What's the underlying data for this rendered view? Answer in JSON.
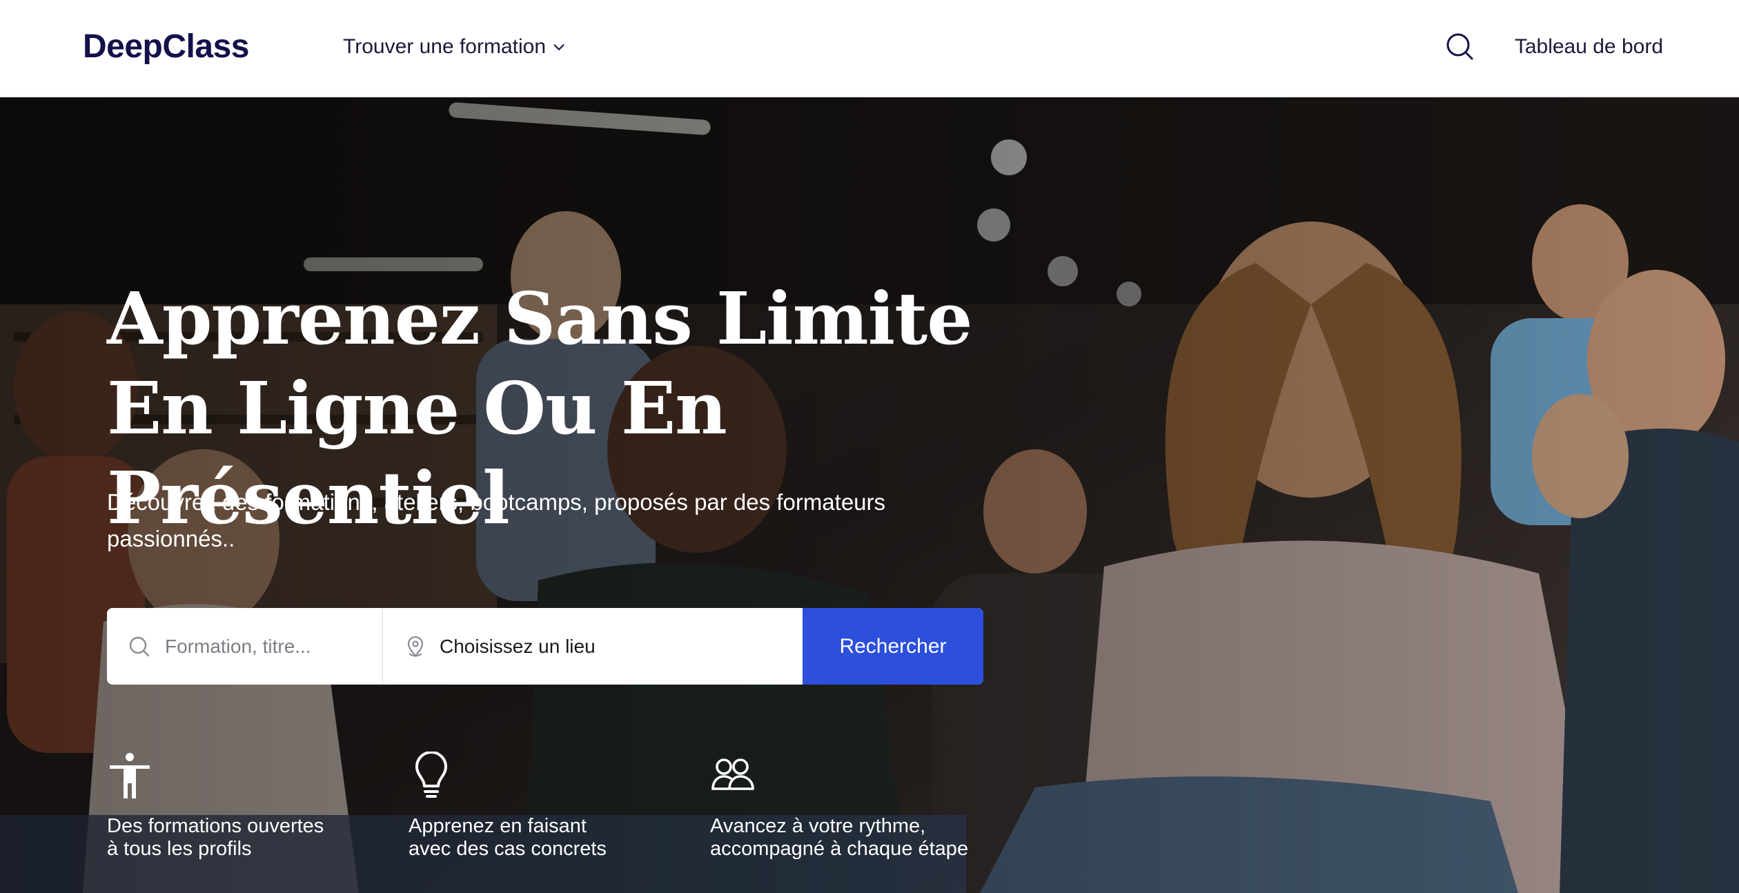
{
  "header": {
    "logo": "DeepClass",
    "nav_dropdown_label": "Trouver une formation",
    "search_icon": "search-icon",
    "dashboard_label": "Tableau de bord",
    "logo_color": "#13114a"
  },
  "hero": {
    "title": "Apprenez Sans Limite En Ligne Ou En Présentiel",
    "subtitle": "Découvrez des formations, ateliers, bootcamps, proposés par des formateurs passionnés..",
    "background": "photo-students-classroom"
  },
  "search": {
    "placeholder": "Formation, titre...",
    "location_label": "Choisissez un lieu",
    "button_label": "Rechercher",
    "button_color": "#2c4fdc"
  },
  "features": [
    {
      "icon": "accessibility-person-icon",
      "text": "Des formations ouvertes\nà tous les profils"
    },
    {
      "icon": "lightbulb-icon",
      "text": "Apprenez en faisant\navec des cas concrets"
    },
    {
      "icon": "users-icon",
      "text": "Avancez à votre rythme,\naccompagné à chaque étape"
    }
  ]
}
